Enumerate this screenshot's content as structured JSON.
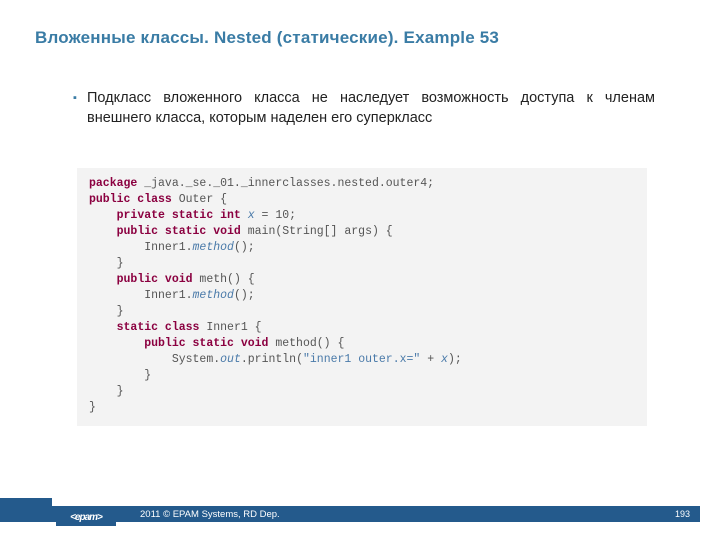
{
  "title": "Вложенные классы. Nested (статические). Example 53",
  "bullet_text": "Подкласс вложенного класса не наследует возможность доступа к членам внешнего класса, которым наделен его суперкласс",
  "code": {
    "ind1": "    ",
    "ind2": "        ",
    "ind3": "            ",
    "l0": {
      "k0": "package",
      "t0": " _java._se._01._innerclasses.nested.outer4;"
    },
    "l1": {
      "k0": "public class",
      "t0": " Outer {"
    },
    "l2": {
      "k0": "private static int",
      "v0": "x",
      "t0": " = 10;"
    },
    "l3": {
      "k0": "public static void",
      "t0": " main(String[] args) {"
    },
    "l4": {
      "t0": "Inner1.",
      "v0": "method",
      "t1": "();"
    },
    "l5": {
      "t0": "}"
    },
    "l6": {
      "k0": "public void",
      "t0": " meth() {"
    },
    "l7": {
      "t0": "Inner1.",
      "v0": "method",
      "t1": "();"
    },
    "l8": {
      "t0": "}"
    },
    "l9": {
      "k0": "static class",
      "t0": " Inner1 {"
    },
    "l10": {
      "k0": "public static void",
      "t0": " method() {"
    },
    "l11": {
      "t0": "System.",
      "v0": "out",
      "t1": ".println(",
      "s0": "\"inner1 outer.x=\"",
      "t2": " + ",
      "v1": "x",
      "t3": ");"
    },
    "l12": {
      "t0": "}"
    },
    "l13": {
      "t0": "}"
    },
    "l14": {
      "t0": "}"
    }
  },
  "footer": {
    "logo": "<epam>",
    "copyright": "2011 © EPAM Systems, RD Dep.",
    "page": "193"
  }
}
